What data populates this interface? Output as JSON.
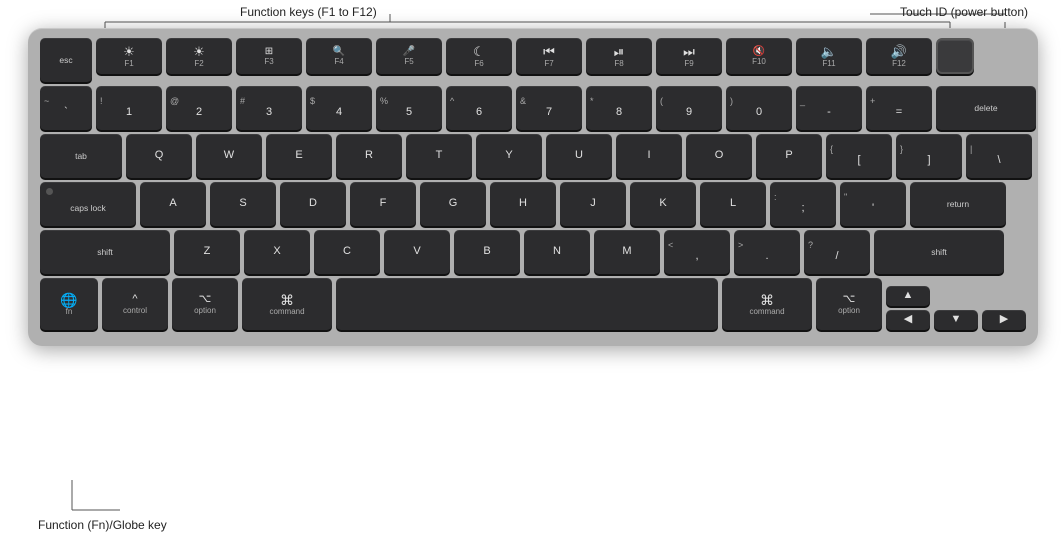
{
  "annotations": {
    "function_keys_label": "Function keys (F1 to F12)",
    "touch_id_label": "Touch ID (power button)",
    "fn_globe_label": "Function (Fn)/Globe key"
  },
  "keyboard": {
    "rows": {
      "row_fn": {
        "keys": [
          "esc",
          "F1",
          "F2",
          "F3",
          "F4",
          "F5",
          "F6",
          "F7",
          "F8",
          "F9",
          "F10",
          "F11",
          "F12"
        ]
      }
    }
  }
}
